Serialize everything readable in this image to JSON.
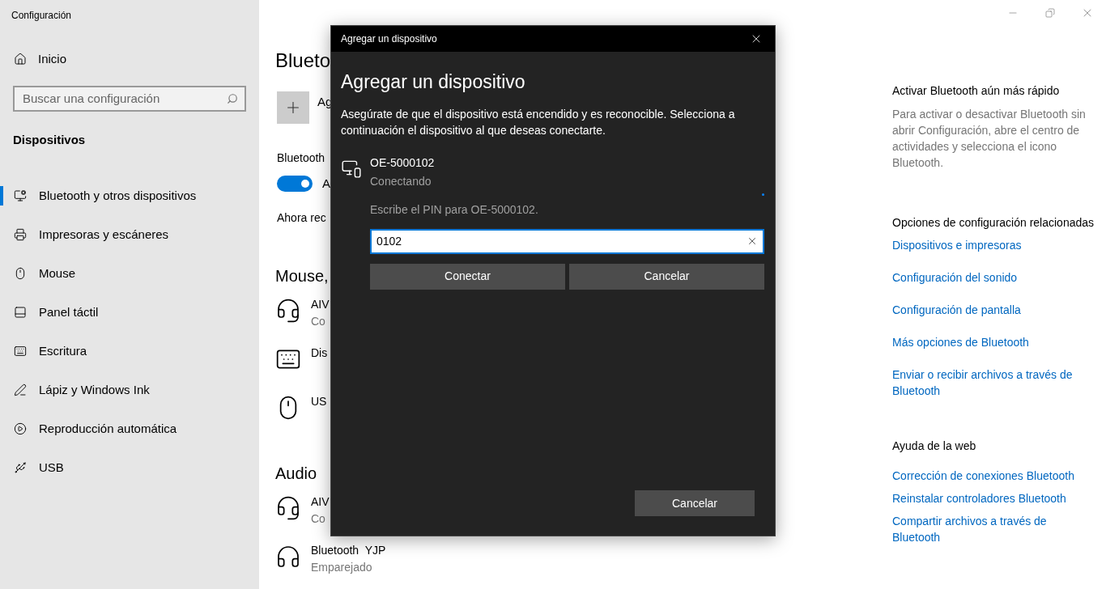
{
  "window": {
    "title": "Configuración"
  },
  "sidebar": {
    "home": "Inicio",
    "search": {
      "placeholder": "Buscar una configuración"
    },
    "section": "Dispositivos",
    "items": [
      {
        "label": "Bluetooth y otros dispositivos",
        "kind": "bluetooth",
        "selected": true
      },
      {
        "label": "Impresoras y escáneres",
        "kind": "printer",
        "selected": false
      },
      {
        "label": "Mouse",
        "kind": "mouse",
        "selected": false
      },
      {
        "label": "Panel táctil",
        "kind": "touchpad",
        "selected": false
      },
      {
        "label": "Escritura",
        "kind": "keyboard",
        "selected": false
      },
      {
        "label": "Lápiz y Windows Ink",
        "kind": "pen",
        "selected": false
      },
      {
        "label": "Reproducción automática",
        "kind": "autoplay",
        "selected": false
      },
      {
        "label": "USB",
        "kind": "usb",
        "selected": false
      }
    ]
  },
  "main": {
    "heading": "Blueto",
    "add_label": "Ag",
    "bluetooth_label": "Bluetooth",
    "toggle": {
      "on": true,
      "label": "A"
    },
    "discoverable_text": "Ahora rec",
    "groups": [
      {
        "title": "Mouse,",
        "devices": [
          {
            "kind": "headset",
            "name": "AIV",
            "status": "Co"
          },
          {
            "kind": "keyboard",
            "name": "Dis"
          },
          {
            "kind": "mouse",
            "name": "US"
          }
        ]
      },
      {
        "title": "Audio",
        "devices": [
          {
            "kind": "headset",
            "name": "AIV",
            "status": "Co"
          },
          {
            "kind": "headphones",
            "name": "Bluetooth  YJP",
            "status": "Emparejado"
          }
        ]
      }
    ]
  },
  "right": {
    "tip_title": "Activar Bluetooth aún más rápido",
    "tip_text": "Para activar o desactivar Bluetooth sin abrir Configuración, abre el centro de actividades y selecciona el icono Bluetooth.",
    "related_title": "Opciones de configuración relacionadas",
    "related_links": [
      "Dispositivos e impresoras",
      "Configuración del sonido",
      "Configuración de pantalla",
      "Más opciones de Bluetooth",
      "Enviar o recibir archivos a través de Bluetooth"
    ],
    "help_title": "Ayuda de la web",
    "help_links": [
      "Corrección de conexiones Bluetooth",
      "Reinstalar controladores Bluetooth",
      "Compartir archivos a través de Bluetooth"
    ]
  },
  "dialog": {
    "title": "Agregar un dispositivo",
    "heading": "Agregar un dispositivo",
    "description": "Asegúrate de que el dispositivo está encendido y es reconocible. Selecciona a continuación el dispositivo al que deseas conectarte.",
    "device": {
      "name": "OE-5000102",
      "status": "Conectando"
    },
    "pin_label": "Escribe el PIN para OE-5000102.",
    "pin_input": {
      "value": "0102"
    },
    "buttons": [
      "Conectar",
      "Cancelar"
    ],
    "footer_button": "Cancelar"
  }
}
